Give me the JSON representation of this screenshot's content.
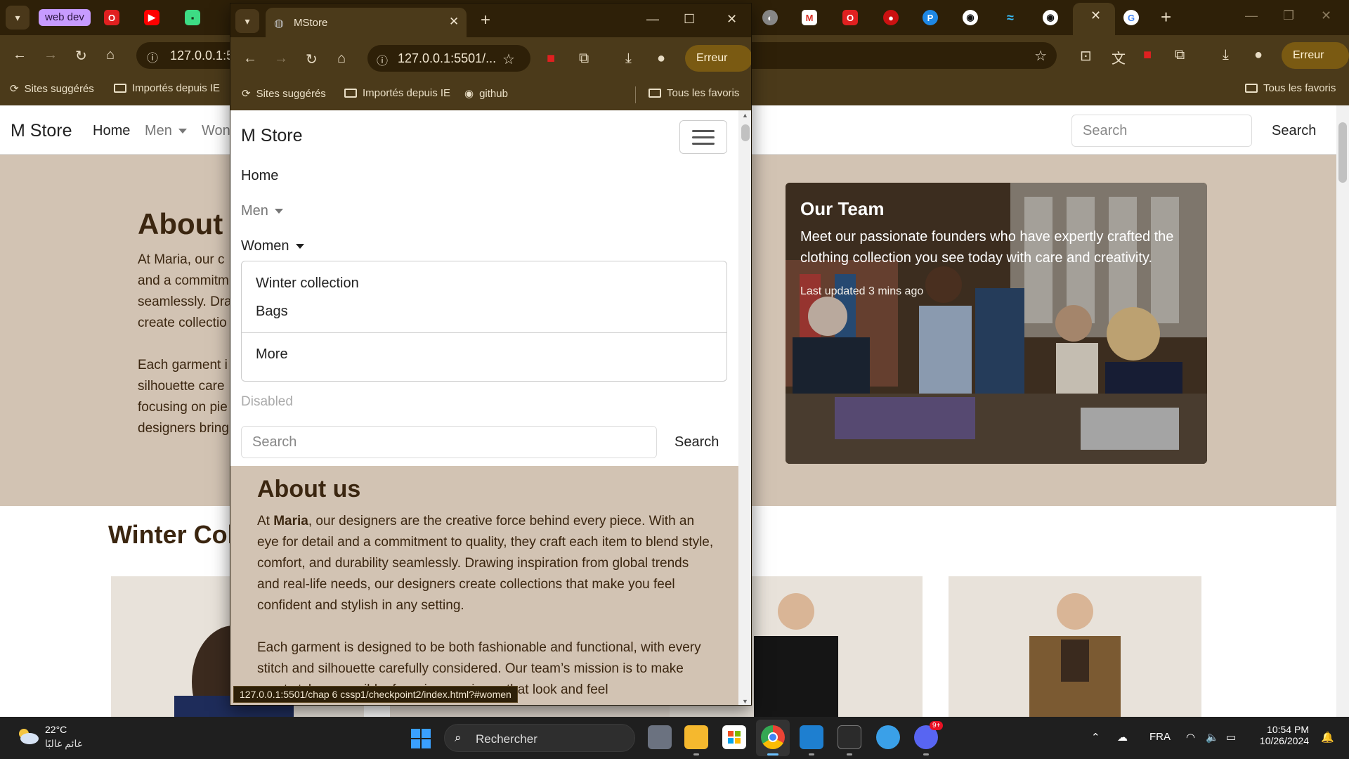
{
  "bg_browser": {
    "group_chip": "web dev",
    "omnibox_url": "127.0.0.1:5",
    "profile_chip": "Erreur",
    "bookmarks": [
      "Sites suggérés",
      "Importés depuis IE"
    ],
    "all_bookmarks": "Tous les favoris"
  },
  "bg_page": {
    "brand": "M Store",
    "nav": [
      "Home",
      "Men",
      "Won"
    ],
    "search_placeholder": "Search",
    "search_button": "Search",
    "about_heading": "About u",
    "about_lines": [
      "At Maria, our c",
      "and a commitm",
      "seamlessly. Dra",
      "create collectio",
      "",
      "Each garment i",
      "silhouette care",
      "focusing on pie",
      "designers bring"
    ],
    "team_title": "Our Team",
    "team_text": "Meet our passionate founders who have expertly crafted the clothing collection you see today with care and creativity.",
    "team_updated": "Last updated 3 mins ago",
    "winter_heading": "Winter Coll"
  },
  "fg_window": {
    "tab_title": "MStore",
    "omnibox_url": "127.0.0.1:5501/...",
    "profile_chip": "Erreur",
    "bookmarks": [
      "Sites suggérés",
      "Importés depuis IE",
      "github"
    ],
    "all_bookmarks": "Tous les favoris",
    "page": {
      "brand": "M Store",
      "nav": {
        "home": "Home",
        "men": "Men",
        "women": "Women",
        "disabled": "Disabled"
      },
      "dropdown": [
        "Winter collection",
        "Bags",
        "More"
      ],
      "search_placeholder": "Search",
      "search_button": "Search",
      "about_heading": "About us",
      "about_p1_prefix": "At ",
      "about_p1_bold": "Maria",
      "about_p1_rest": ", our designers are the creative force behind every piece. With an eye for detail and a commitment to quality, they craft each item to blend style, comfort, and durability seamlessly. Drawing inspiration from global trends and real-life needs, our designers create collections that make you feel confident and stylish in any setting.",
      "about_p2": "Each garment is designed to be both fashionable and functional, with every stitch and silhouette carefully considered. Our team’s mission is to make great style accessible, focusing on pieces that look and feel"
    },
    "status_url": "127.0.0.1:5501/chap 6 cssp1/checkpoint2/index.html?#women"
  },
  "taskbar": {
    "weather_temp": "22°C",
    "weather_desc": "غائم غالبًا",
    "search_label": "Rechercher",
    "language": "FRA",
    "time": "10:54 PM",
    "date": "10/26/2024",
    "discord_badge": "9+"
  }
}
